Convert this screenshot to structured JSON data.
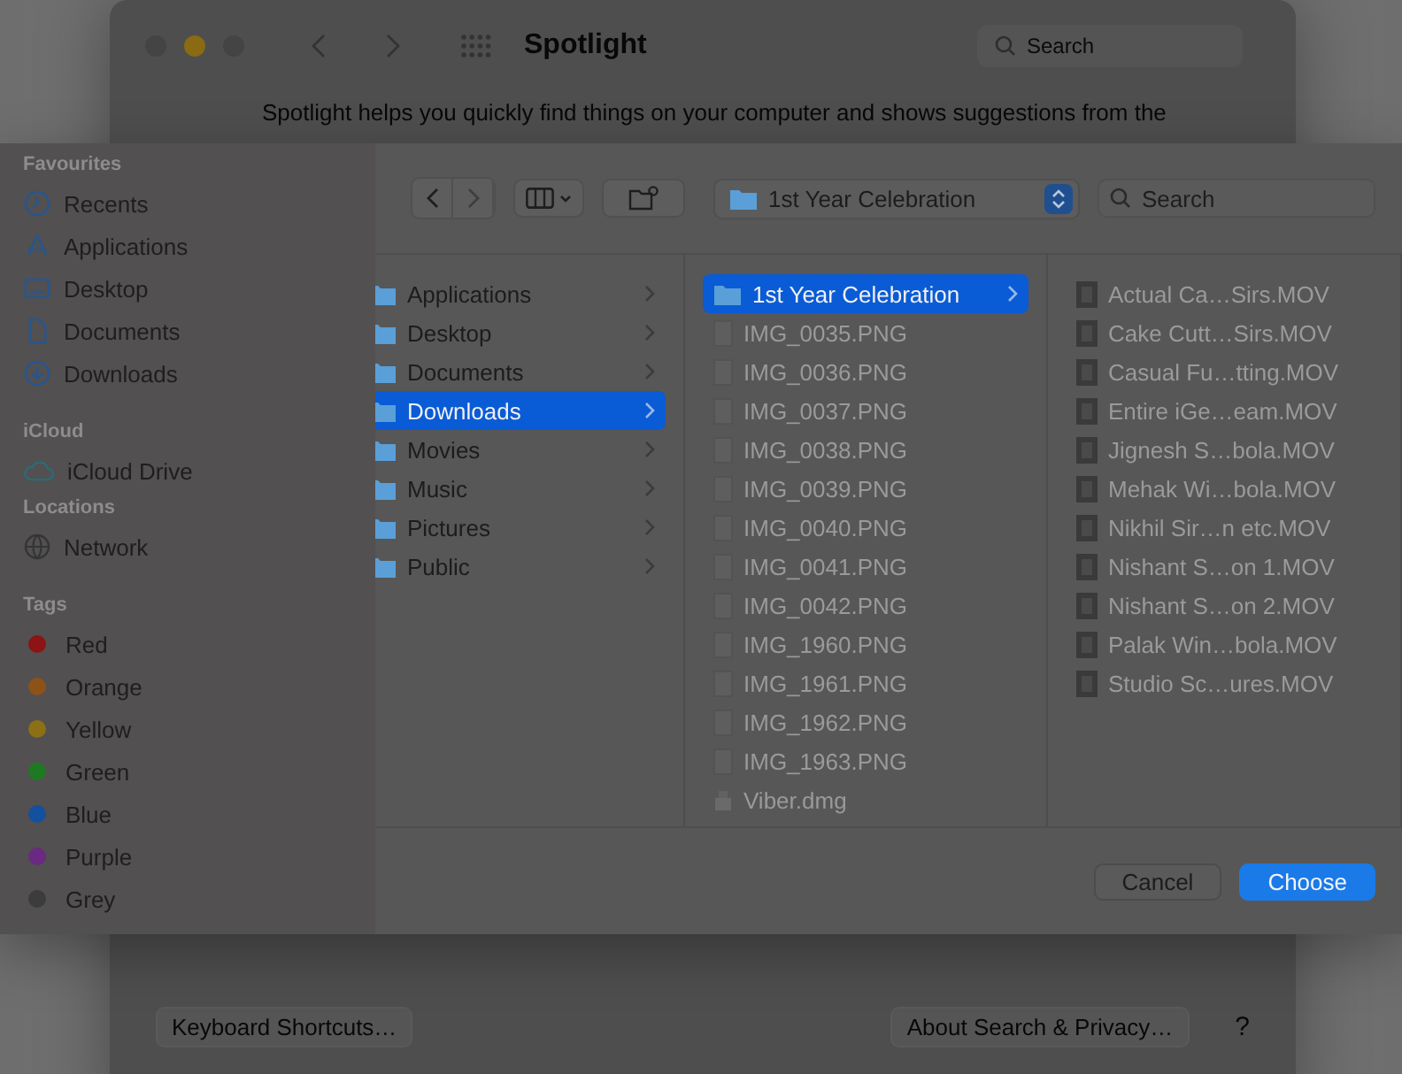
{
  "background_window": {
    "title": "Spotlight",
    "search": {
      "placeholder": "Search"
    },
    "description": "Spotlight helps you quickly find things on your computer and shows suggestions from the",
    "buttons": [
      "Keyboard Shortcuts…",
      "About Search & Privacy…"
    ],
    "help": "?"
  },
  "dialog": {
    "sidebar": [
      {
        "heading": "Favourites",
        "items": [
          {
            "label": "Recents",
            "kind": "clock"
          },
          {
            "label": "Applications",
            "kind": "apps"
          },
          {
            "label": "Desktop",
            "kind": "desktop"
          },
          {
            "label": "Documents",
            "kind": "document"
          },
          {
            "label": "Downloads",
            "kind": "download"
          }
        ]
      },
      {
        "heading": "iCloud",
        "items": [
          {
            "label": "iCloud Drive",
            "kind": "cloud"
          }
        ]
      },
      {
        "heading": "Locations",
        "items": [
          {
            "label": "Network",
            "kind": "globe"
          }
        ]
      },
      {
        "heading": "Tags",
        "items": [
          {
            "label": "Red",
            "kind": "tag",
            "color": "#8c1414"
          },
          {
            "label": "Orange",
            "kind": "tag",
            "color": "#8c5218"
          },
          {
            "label": "Yellow",
            "kind": "tag",
            "color": "#8c7014"
          },
          {
            "label": "Green",
            "kind": "tag",
            "color": "#1e7a22"
          },
          {
            "label": "Blue",
            "kind": "tag",
            "color": "#1450a0"
          },
          {
            "label": "Purple",
            "kind": "tag",
            "color": "#6a2a82"
          },
          {
            "label": "Grey",
            "kind": "tag",
            "color": "#3c3c3c"
          }
        ]
      }
    ],
    "toolbar": {
      "location": "1st Year Celebration",
      "search": {
        "placeholder": "Search"
      }
    },
    "columns": [
      {
        "items": [
          {
            "label": "Applications",
            "kind": "folder",
            "selected": false
          },
          {
            "label": "Desktop",
            "kind": "folder",
            "selected": false
          },
          {
            "label": "Documents",
            "kind": "folder",
            "selected": false
          },
          {
            "label": "Downloads",
            "kind": "folder",
            "selected": true
          },
          {
            "label": "Movies",
            "kind": "folder",
            "selected": false
          },
          {
            "label": "Music",
            "kind": "folder",
            "selected": false
          },
          {
            "label": "Pictures",
            "kind": "folder",
            "selected": false
          },
          {
            "label": "Public",
            "kind": "folder",
            "selected": false
          }
        ]
      },
      {
        "items": [
          {
            "label": "1st Year Celebration",
            "kind": "folder",
            "selected": true
          },
          {
            "label": "IMG_0035.PNG",
            "kind": "image",
            "disabled": true
          },
          {
            "label": "IMG_0036.PNG",
            "kind": "image",
            "disabled": true
          },
          {
            "label": "IMG_0037.PNG",
            "kind": "image",
            "disabled": true
          },
          {
            "label": "IMG_0038.PNG",
            "kind": "image",
            "disabled": true
          },
          {
            "label": "IMG_0039.PNG",
            "kind": "image",
            "disabled": true
          },
          {
            "label": "IMG_0040.PNG",
            "kind": "image",
            "disabled": true
          },
          {
            "label": "IMG_0041.PNG",
            "kind": "image",
            "disabled": true
          },
          {
            "label": "IMG_0042.PNG",
            "kind": "image",
            "disabled": true
          },
          {
            "label": "IMG_1960.PNG",
            "kind": "image",
            "disabled": true
          },
          {
            "label": "IMG_1961.PNG",
            "kind": "image",
            "disabled": true
          },
          {
            "label": "IMG_1962.PNG",
            "kind": "image",
            "disabled": true
          },
          {
            "label": "IMG_1963.PNG",
            "kind": "image",
            "disabled": true
          },
          {
            "label": "Viber.dmg",
            "kind": "disk",
            "disabled": true
          }
        ]
      },
      {
        "items": [
          {
            "label": "Actual Ca…Sirs.MOV",
            "kind": "video",
            "disabled": true
          },
          {
            "label": "Cake Cutt…Sirs.MOV",
            "kind": "video",
            "disabled": true
          },
          {
            "label": "Casual Fu…tting.MOV",
            "kind": "video",
            "disabled": true
          },
          {
            "label": "Entire iGe…eam.MOV",
            "kind": "video",
            "disabled": true
          },
          {
            "label": "Jignesh S…bola.MOV",
            "kind": "video",
            "disabled": true
          },
          {
            "label": "Mehak Wi…bola.MOV",
            "kind": "video",
            "disabled": true
          },
          {
            "label": "Nikhil Sir…n etc.MOV",
            "kind": "video",
            "disabled": true
          },
          {
            "label": "Nishant S…on 1.MOV",
            "kind": "video",
            "disabled": true
          },
          {
            "label": "Nishant S…on 2.MOV",
            "kind": "video",
            "disabled": true
          },
          {
            "label": "Palak Win…bola.MOV",
            "kind": "video",
            "disabled": true
          },
          {
            "label": "Studio Sc…ures.MOV",
            "kind": "video",
            "disabled": true
          }
        ]
      }
    ],
    "buttons": [
      {
        "label": "Cancel",
        "kind": "secondary"
      },
      {
        "label": "Choose",
        "kind": "default"
      }
    ]
  }
}
